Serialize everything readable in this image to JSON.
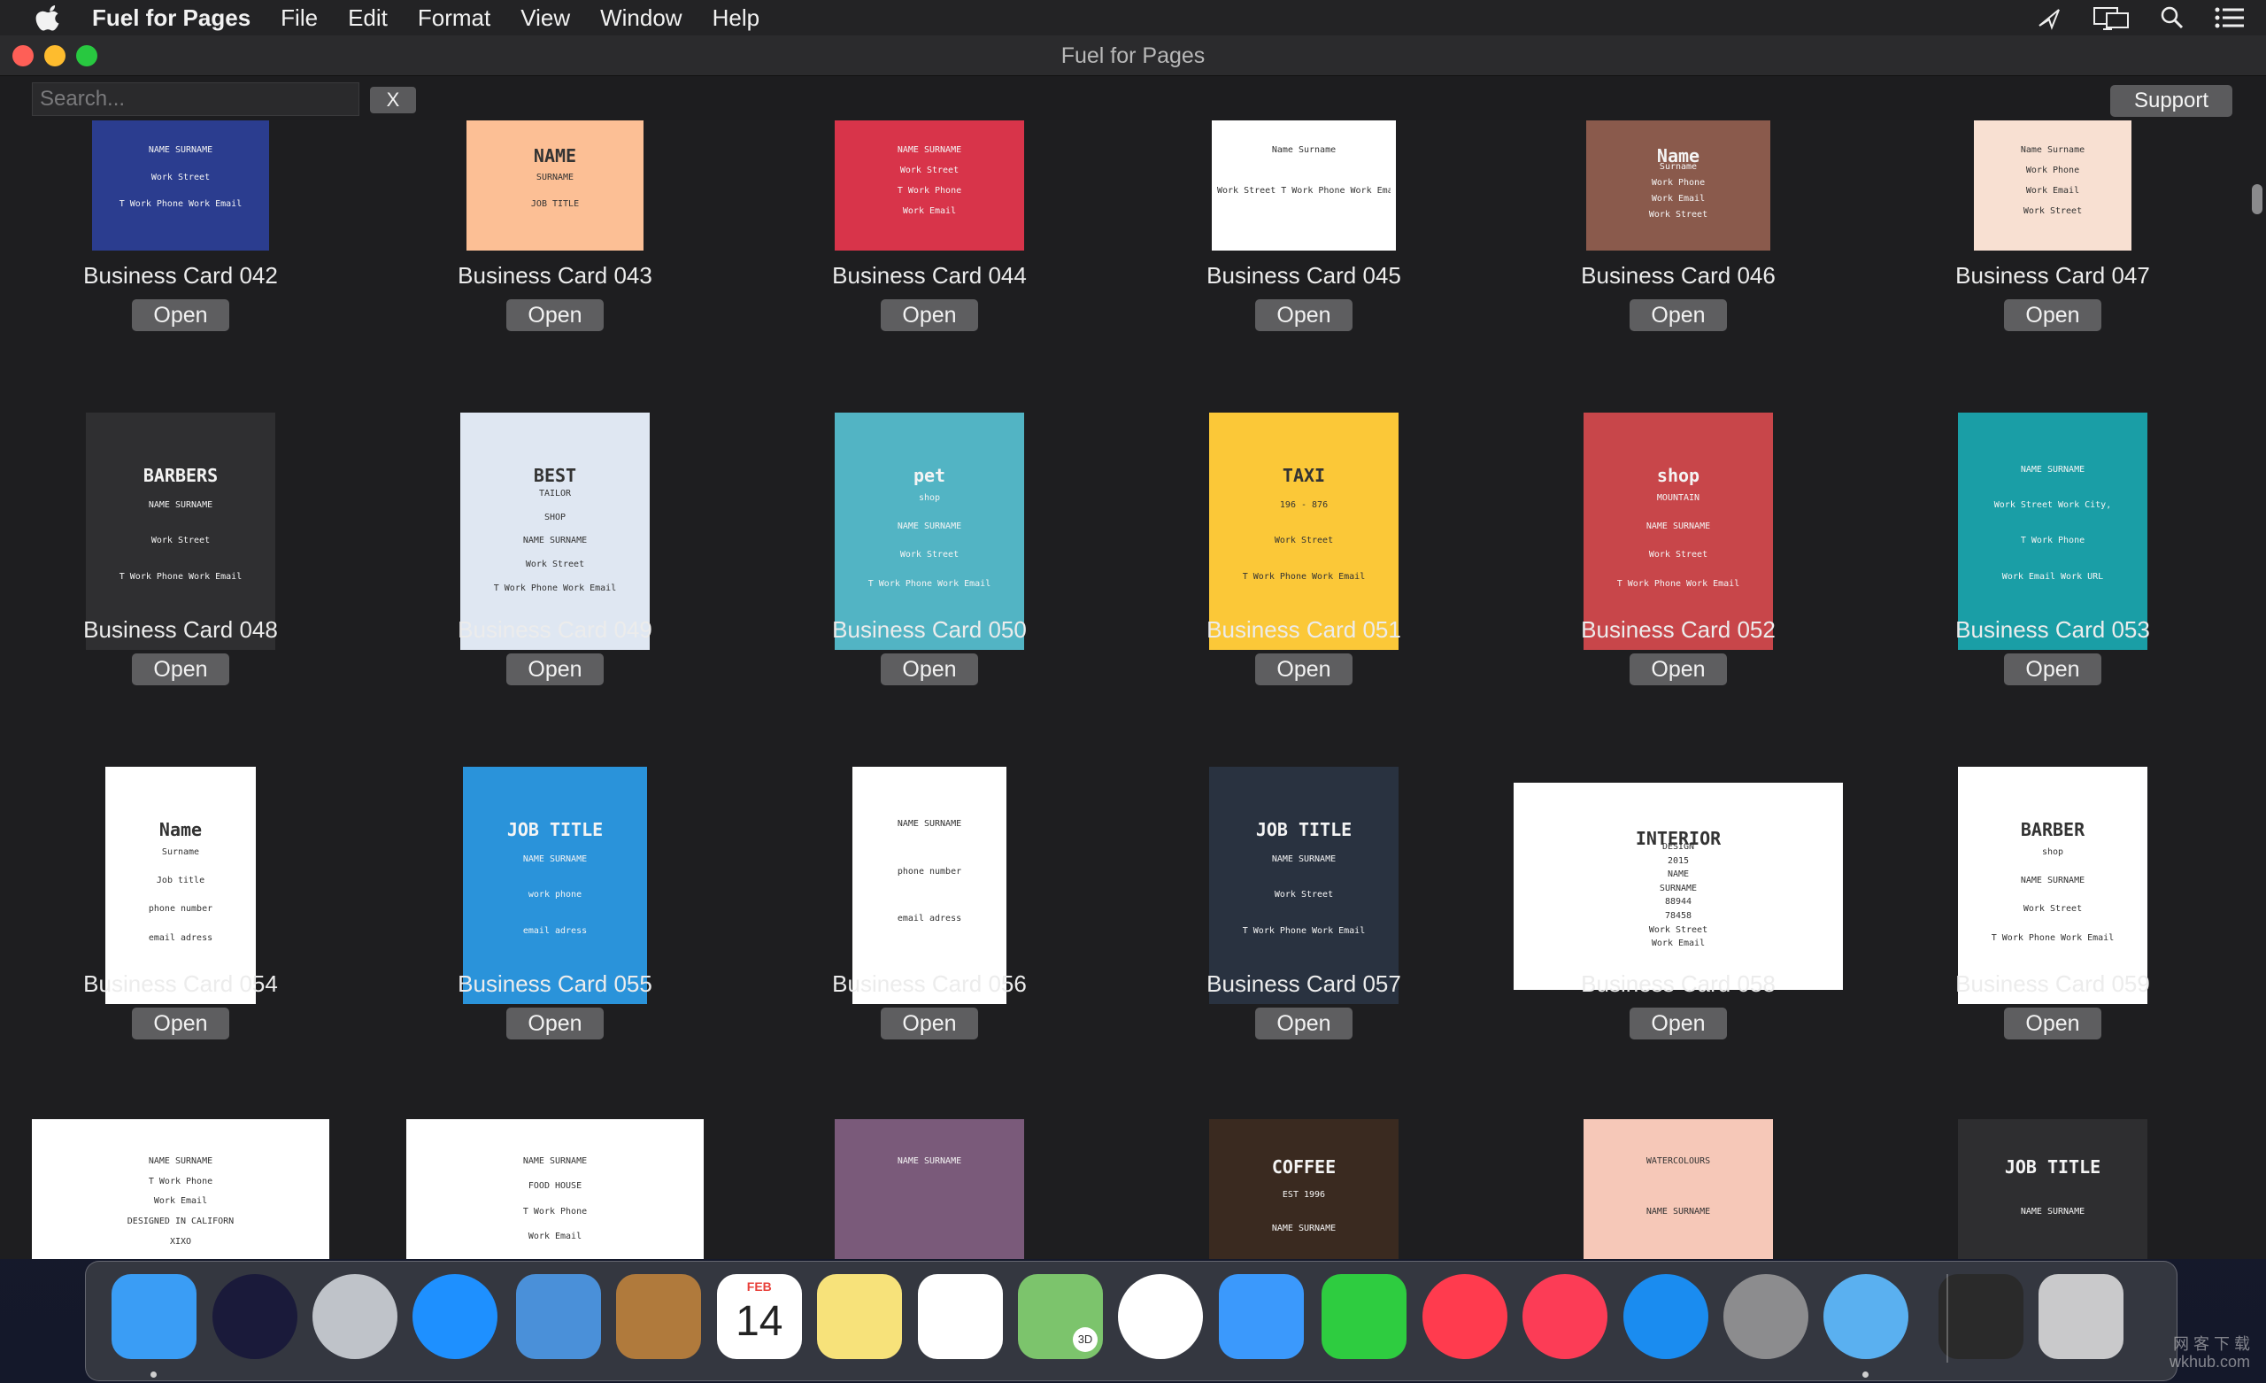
{
  "menubar": {
    "app_name": "Fuel for Pages",
    "items": [
      "File",
      "Edit",
      "Format",
      "View",
      "Window",
      "Help"
    ],
    "right_icons": [
      "airdrop-icon",
      "display-mirroring-icon",
      "spotlight-search-icon",
      "notification-center-icon"
    ]
  },
  "window": {
    "title": "Fuel for Pages",
    "search_placeholder": "Search...",
    "clear_label": "X",
    "support_label": "Support"
  },
  "templates": [
    {
      "name": "Business Card 042",
      "open": "Open",
      "bg": "#2b3d8f",
      "texts": [
        "NAME SURNAME",
        "Work Street",
        "T Work Phone Work Email"
      ]
    },
    {
      "name": "Business Card 043",
      "open": "Open",
      "bg": "#fcbf95",
      "texts": [
        "NAME",
        "SURNAME",
        "JOB TITLE"
      ]
    },
    {
      "name": "Business Card 044",
      "open": "Open",
      "bg": "#d8344a",
      "texts": [
        "NAME SURNAME",
        "Work Street",
        "T Work Phone",
        "Work Email"
      ]
    },
    {
      "name": "Business Card 045",
      "open": "Open",
      "bg": "#ffffff",
      "texts": [
        "Name Surname",
        "Work Street T Work Phone Work Email"
      ]
    },
    {
      "name": "Business Card 046",
      "open": "Open",
      "bg": "#8a5a4c",
      "texts": [
        "Name",
        "Surname",
        "Work Phone",
        "Work Email",
        "Work Street"
      ]
    },
    {
      "name": "Business Card 047",
      "open": "Open",
      "bg": "#f8e0d2",
      "texts": [
        "Name Surname",
        "Work Phone",
        "Work Email",
        "Work Street"
      ]
    },
    {
      "name": "Business Card 048",
      "open": "Open",
      "bg": "#2f2f31",
      "texts": [
        "BARBERS",
        "NAME SURNAME",
        "Work Street",
        "T Work Phone Work Email"
      ]
    },
    {
      "name": "Business Card 049",
      "open": "Open",
      "bg": "#dfe7f2",
      "texts": [
        "BEST",
        "TAILOR",
        "SHOP",
        "NAME SURNAME",
        "Work Street",
        "T Work Phone Work Email"
      ]
    },
    {
      "name": "Business Card 050",
      "open": "Open",
      "bg": "#52b4c4",
      "texts": [
        "pet",
        "shop",
        "NAME SURNAME",
        "Work Street",
        "T Work Phone Work Email"
      ]
    },
    {
      "name": "Business Card 051",
      "open": "Open",
      "bg": "#fbc838",
      "texts": [
        "TAXI",
        "196 - 876",
        "Work Street",
        "T Work Phone Work Email"
      ]
    },
    {
      "name": "Business Card 052",
      "open": "Open",
      "bg": "#c8464a",
      "texts": [
        "shop",
        "MOUNTAIN",
        "NAME SURNAME",
        "Work Street",
        "T Work Phone Work Email"
      ]
    },
    {
      "name": "Business Card 053",
      "open": "Open",
      "bg": "#1a9ea6",
      "texts": [
        "NAME SURNAME",
        "Work Street Work City,",
        "T Work Phone",
        "Work Email Work URL"
      ]
    },
    {
      "name": "Business Card 054",
      "open": "Open",
      "bg": "#ffffff",
      "texts": [
        "Name",
        "Surname",
        "Job title",
        "phone number",
        "email adress"
      ]
    },
    {
      "name": "Business Card 055",
      "open": "Open",
      "bg": "#2a93da",
      "texts": [
        "JOB TITLE",
        "NAME SURNAME",
        "work phone",
        "email adress"
      ]
    },
    {
      "name": "Business Card 056",
      "open": "Open",
      "bg": "#ffffff",
      "texts": [
        "NAME SURNAME",
        "phone number",
        "email adress"
      ]
    },
    {
      "name": "Business Card 057",
      "open": "Open",
      "bg": "#293240",
      "texts": [
        "JOB TITLE",
        "NAME SURNAME",
        "Work Street",
        "T Work Phone Work Email"
      ]
    },
    {
      "name": "Business Card 058",
      "open": "Open",
      "bg": "#ffffff",
      "texts": [
        "INTERIOR",
        "DESIGN",
        "2015",
        "NAME",
        "SURNAME",
        "88944",
        "78458",
        "Work Street",
        "Work Email"
      ]
    },
    {
      "name": "Business Card 059",
      "open": "Open",
      "bg": "#ffffff",
      "texts": [
        "BARBER",
        "shop",
        "NAME SURNAME",
        "Work Street",
        "T Work Phone Work Email"
      ]
    },
    {
      "name": "",
      "open": "",
      "bg": "#ffffff",
      "texts": [
        "NAME SURNAME",
        "T Work Phone",
        "Work Email",
        "DESIGNED IN CALIFORN",
        "XIXO"
      ]
    },
    {
      "name": "",
      "open": "",
      "bg": "#ffffff",
      "texts": [
        "NAME SURNAME",
        "FOOD HOUSE",
        "T Work Phone",
        "Work Email"
      ]
    },
    {
      "name": "",
      "open": "",
      "bg": "#7a5a7a",
      "texts": [
        "NAME SURNAME"
      ]
    },
    {
      "name": "",
      "open": "",
      "bg": "#3a2a20",
      "texts": [
        "COFFEE",
        "EST 1996",
        "NAME SURNAME"
      ]
    },
    {
      "name": "",
      "open": "",
      "bg": "#f6c8b8",
      "texts": [
        "WATERCOLOURS",
        "NAME SURNAME"
      ]
    },
    {
      "name": "",
      "open": "",
      "bg": "#2e2e30",
      "texts": [
        "JOB TITLE",
        "NAME SURNAME"
      ]
    }
  ],
  "dock": {
    "apps": [
      {
        "name": "finder-icon",
        "color": "#3a9df5",
        "running": true
      },
      {
        "name": "siri-icon",
        "color": "#1a1a3a",
        "running": false
      },
      {
        "name": "launchpad-icon",
        "color": "#bfc3c9",
        "running": false
      },
      {
        "name": "safari-icon",
        "color": "#1e90ff",
        "running": false
      },
      {
        "name": "mail-icon",
        "color": "#4a90d9",
        "running": false
      },
      {
        "name": "contacts-icon",
        "color": "#b07a3c",
        "running": false
      },
      {
        "name": "calendar-icon",
        "color": "#ffffff",
        "running": false,
        "month": "FEB",
        "day": "14"
      },
      {
        "name": "notes-icon",
        "color": "#f7e27a",
        "running": false
      },
      {
        "name": "reminders-icon",
        "color": "#ffffff",
        "running": false
      },
      {
        "name": "maps-icon",
        "color": "#7cc46c",
        "running": false,
        "badge": "3D"
      },
      {
        "name": "photos-icon",
        "color": "#ffffff",
        "running": false
      },
      {
        "name": "messages-icon",
        "color": "#3b99fc",
        "running": false
      },
      {
        "name": "facetime-icon",
        "color": "#2ecc40",
        "running": false
      },
      {
        "name": "news-icon",
        "color": "#ff3b4e",
        "running": false
      },
      {
        "name": "music-icon",
        "color": "#fc3c56",
        "running": false
      },
      {
        "name": "app-store-icon",
        "color": "#1a8cf0",
        "running": false
      },
      {
        "name": "system-preferences-icon",
        "color": "#8c8c8e",
        "running": false
      },
      {
        "name": "fuel-for-pages-icon",
        "color": "#5ab0f0",
        "running": true
      },
      {
        "name": "downloads-stack-icon",
        "color": "#2a2a2a",
        "running": false
      },
      {
        "name": "trash-icon",
        "color": "#c9c9cb",
        "running": false
      }
    ]
  },
  "watermark": {
    "line1": "网 客 下 载",
    "line2": "wkhub.com"
  }
}
